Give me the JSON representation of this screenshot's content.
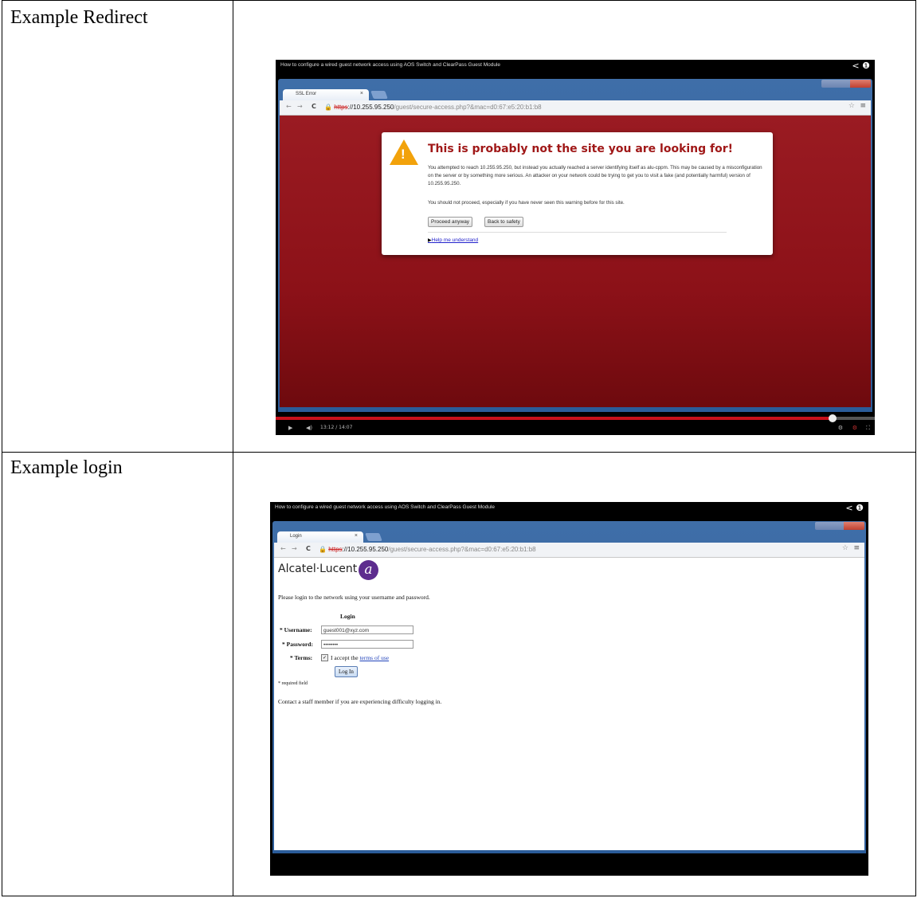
{
  "rows": [
    {
      "label": "Example Redirect"
    },
    {
      "label": "Example login"
    }
  ],
  "redirect_video": {
    "video_title": "How to configure a wired guest network access using AOS Switch and ClearPass Guest Module",
    "tab_title": "SSL Error",
    "address": {
      "scheme": "https",
      "host_path": "://10.255.95.250",
      "rest": "/guest/secure-access.php?&mac=d0:67:e5:20:b1:b8"
    },
    "error_title": "This is probably not the site you are looking for!",
    "error_text_1": "You attempted to reach 10.255.95.250, but instead you actually reached a server identifying itself as alu-cppm. This may be caused by a misconfiguration on the server or by something more serious. An attacker on your network could be trying to get you to visit a fake (and potentially harmful) version of 10.255.95.250.",
    "error_text_2": "You should not proceed, especially if you have never seen this warning before for this site.",
    "proceed_label": "Proceed anyway",
    "back_label": "Back to safety",
    "help_link": "Help me understand",
    "time_display": "13:12 / 14:07",
    "progress_fraction": 0.93
  },
  "login_video": {
    "video_title": "How to configure a wired guest network access using AOS Switch and ClearPass Guest Module",
    "tab_title": "Login",
    "address": {
      "scheme": "https",
      "host_path": "://10.255.95.250",
      "rest": "/guest/secure-access.php?&mac=d0:67:e5:20:b1:b8"
    },
    "logo_text": "Alcatel·Lucent",
    "intro": "Please login to the network using your username and password.",
    "form_heading": "Login",
    "username_label": "* Username:",
    "username_value": "guest001@xyz.com",
    "password_label": "* Password:",
    "password_value": "••••••••",
    "terms_label": "* Terms:",
    "terms_prefix": "I accept the",
    "terms_link": "terms of use",
    "login_button": "Log In",
    "required_note": "* required field",
    "contact_text": "Contact a staff member if you are experiencing difficulty logging in."
  }
}
